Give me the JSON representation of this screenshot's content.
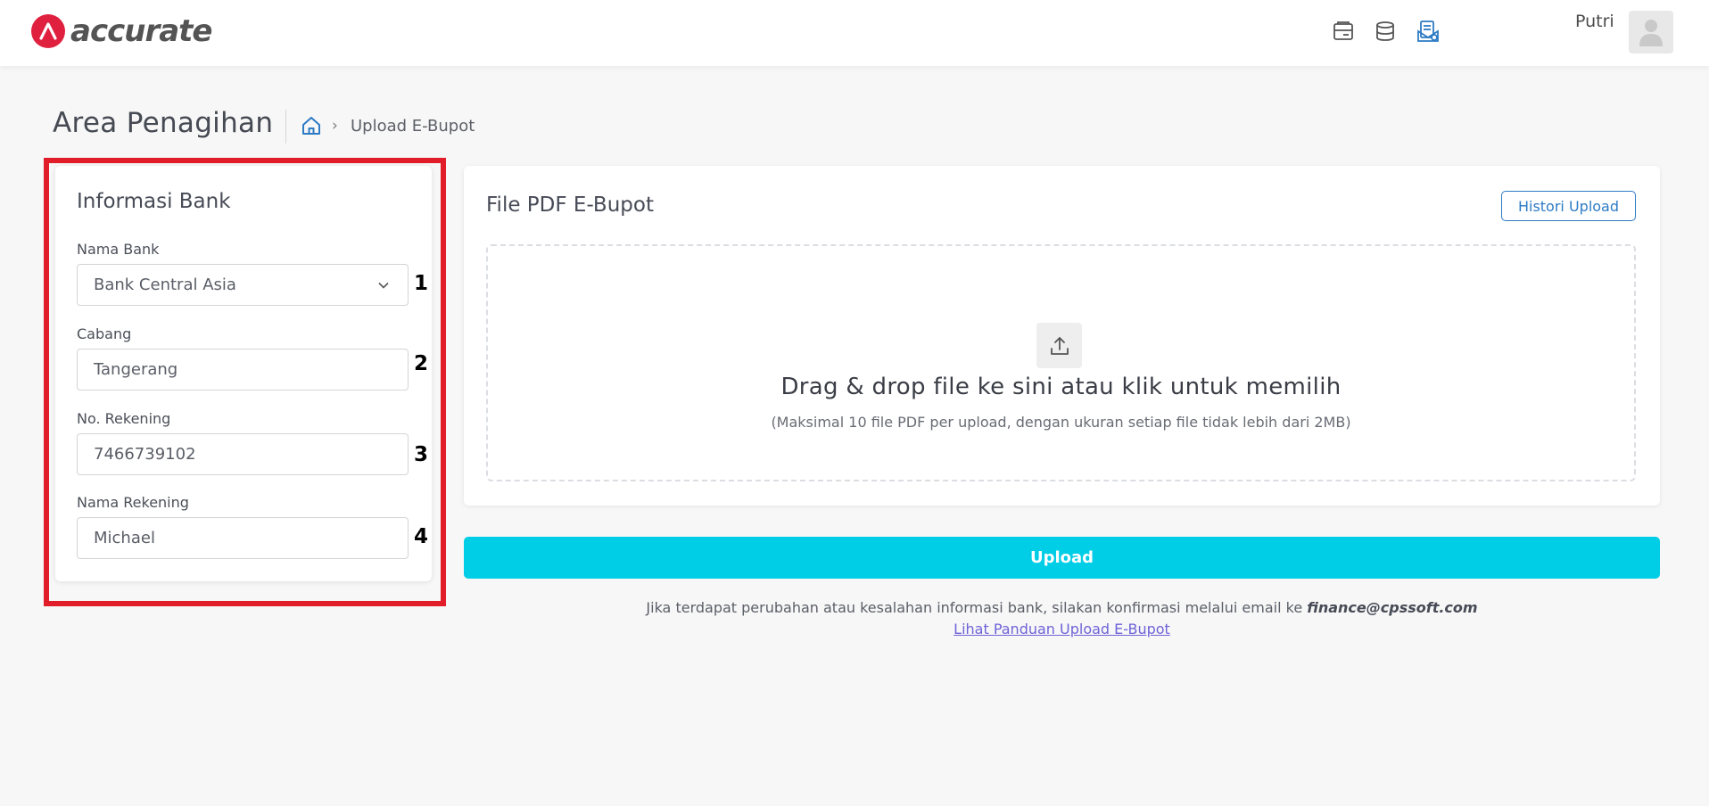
{
  "app": {
    "brand": "accurate",
    "user_name": "Putri",
    "colors": {
      "brand_red": "#e0203f",
      "accent_cyan": "#00cde6",
      "link_blue": "#2d7bc4",
      "highlight_red": "#e11d2a"
    }
  },
  "header_icons": [
    "card-icon",
    "database-icon",
    "invoice-settings-icon"
  ],
  "breadcrumb": {
    "page_title": "Area Penagihan",
    "current": "Upload E-Bupot"
  },
  "bank_info": {
    "title": "Informasi Bank",
    "fields": [
      {
        "label": "Nama Bank",
        "value": "Bank Central Asia",
        "marker": "1"
      },
      {
        "label": "Cabang",
        "value": "Tangerang",
        "marker": "2"
      },
      {
        "label": "No. Rekening",
        "value": "7466739102",
        "marker": "3"
      },
      {
        "label": "Nama Rekening",
        "value": "Michael",
        "marker": "4"
      }
    ]
  },
  "upload": {
    "title": "File PDF E-Bupot",
    "history_button": "Histori Upload",
    "dropzone_main": "Drag & drop file ke sini atau klik untuk memilih",
    "dropzone_sub": "(Maksimal 10 file PDF per upload, dengan ukuran setiap file tidak lebih dari 2MB)",
    "button": "Upload"
  },
  "footer": {
    "info_text": "Jika terdapat perubahan atau kesalahan informasi bank, silakan konfirmasi melalui email ke ",
    "email": "finance@cpssoft.com",
    "guide_link": "Lihat Panduan Upload E-Bupot"
  }
}
